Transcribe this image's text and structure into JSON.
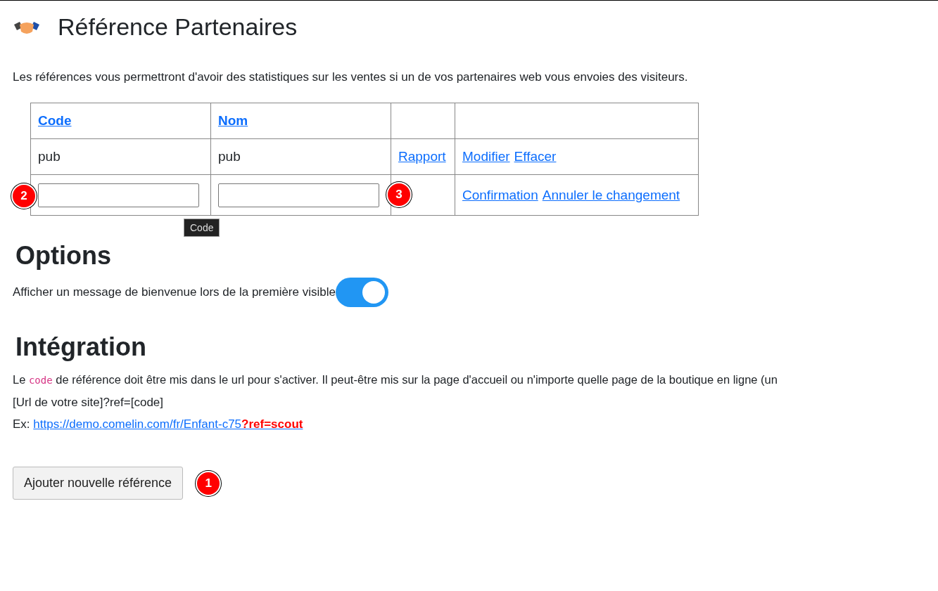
{
  "page": {
    "title": "Référence Partenaires",
    "intro": "Les références vous permettront d'avoir des statistiques sur les ventes si un de vos partenaires web vous envoies des visiteurs."
  },
  "table": {
    "columns": [
      {
        "label": "Code"
      },
      {
        "label": "Nom"
      }
    ],
    "rows": [
      {
        "code": "pub",
        "name": "pub",
        "report_link": "Rapport",
        "actions": [
          "Modifier",
          "Effacer"
        ]
      }
    ],
    "edit_row": {
      "code_field": {
        "badge": "2",
        "tooltip": "Code"
      },
      "name_field": {
        "badge": "3"
      },
      "actions": [
        "Confirmation",
        "Annuler le changement"
      ]
    }
  },
  "options": {
    "heading": "Options",
    "welcome_message": {
      "label": "Afficher un message de bienvenue lors de la première visible",
      "on": true
    }
  },
  "integration": {
    "heading": "Intégration",
    "text_before": "Le",
    "code_word": "code",
    "text_after": "de référence doit être mis dans le url pour s'activer. Il peut-être mis sur la page d'accueil ou n'importe quelle page de la boutique en ligne (un",
    "pattern": "[Url de votre site]?ref=[code]",
    "example_label": "Ex:",
    "example_url": "https://demo.comelin.com/fr/Enfant-c75",
    "example_param": "?ref=scout"
  },
  "add_button": {
    "label": "Ajouter nouvelle référence",
    "badge": "1"
  }
}
